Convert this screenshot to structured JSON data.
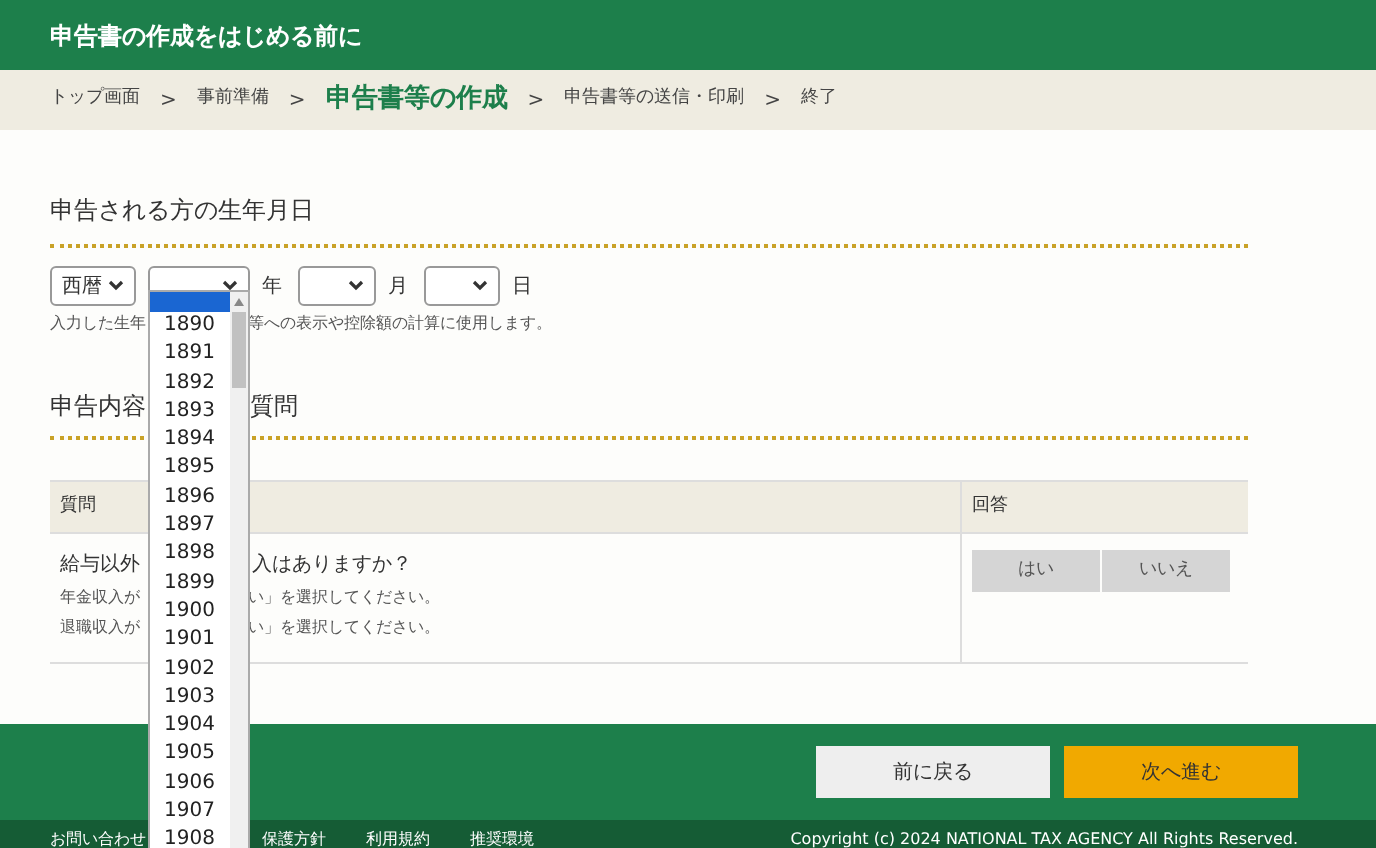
{
  "header": {
    "title": "申告書の作成をはじめる前に"
  },
  "breadcrumb": [
    {
      "label": "トップ画面",
      "selected": false
    },
    {
      "label": "事前準備",
      "selected": false
    },
    {
      "label": "申告書等の作成",
      "selected": true
    },
    {
      "label": "申告書等の送信・印刷",
      "selected": false
    },
    {
      "label": "終了",
      "selected": false
    }
  ],
  "breadcrumb_separator": ">",
  "birth_section": {
    "heading": "申告される方の生年月日",
    "era_select": {
      "value": "西暦"
    },
    "year_select": {
      "unit": "年"
    },
    "month_select": {
      "unit": "月"
    },
    "day_select": {
      "unit": "日"
    },
    "hint_parts": [
      "入力した生年",
      "等への表示や控除額の計算に使用します。"
    ]
  },
  "question_section": {
    "heading_parts": [
      "申告内容",
      "質問"
    ],
    "table": {
      "columns": [
        "質問",
        "回答"
      ],
      "rows": [
        {
          "question_parts": [
            "給与以外",
            "入はありますか？"
          ],
          "notes": [
            [
              "年金収入が",
              "い」を選択してください。"
            ],
            [
              "退職収入が",
              "い」を選択してください。"
            ]
          ],
          "answers": [
            {
              "label": "はい",
              "selected": false
            },
            {
              "label": "いいえ",
              "selected": false
            }
          ]
        }
      ]
    }
  },
  "year_dropdown": {
    "open": true,
    "blank_option_selected": true,
    "options": [
      {
        "label": "1890"
      },
      {
        "label": "1891"
      },
      {
        "label": "1892"
      },
      {
        "label": "1893"
      },
      {
        "label": "1894"
      },
      {
        "label": "1895"
      },
      {
        "label": "1896"
      },
      {
        "label": "1897"
      },
      {
        "label": "1898"
      },
      {
        "label": "1899"
      },
      {
        "label": "1900"
      },
      {
        "label": "1901"
      },
      {
        "label": "1902"
      },
      {
        "label": "1903"
      },
      {
        "label": "1904"
      },
      {
        "label": "1905"
      },
      {
        "label": "1906"
      },
      {
        "label": "1907"
      },
      {
        "label": "1908"
      }
    ]
  },
  "nav_buttons": [
    {
      "label": "前に戻る",
      "kind": "back"
    },
    {
      "label": "次へ進む",
      "kind": "next"
    }
  ],
  "footer": {
    "links": [
      "お問い合わせ",
      "保護方針",
      "利用規約",
      "推奨環境"
    ],
    "copyright": "Copyright (c) 2024 NATIONAL TAX AGENCY All Rights Reserved."
  }
}
